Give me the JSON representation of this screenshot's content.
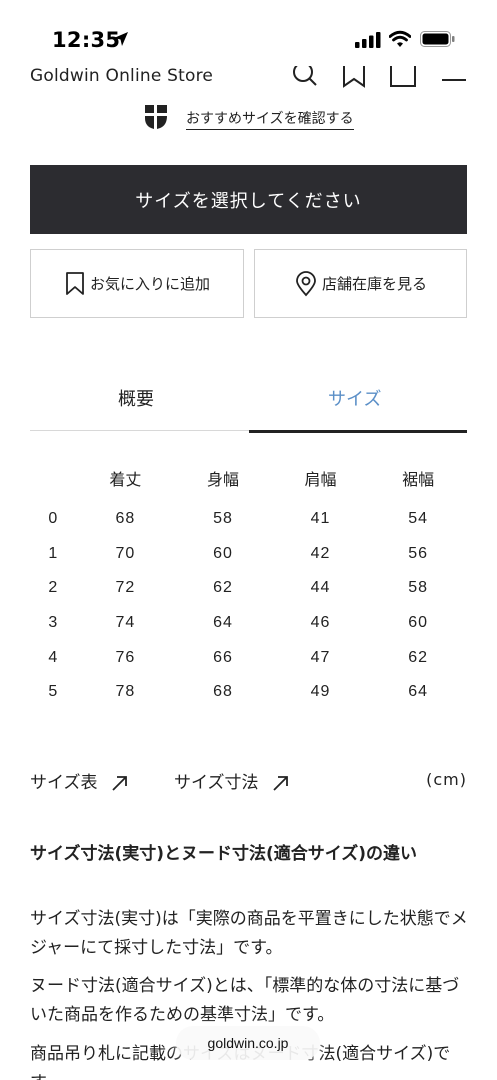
{
  "status_bar": {
    "time": "12:35"
  },
  "header": {
    "store_name": "Goldwin Online Store",
    "icons": [
      "search-icon",
      "bookmark-icon",
      "bag-icon",
      "menu-icon"
    ]
  },
  "recommend": {
    "link_label": "おすすめサイズを確認する"
  },
  "buttons": {
    "select_size": "サイズを選択してください",
    "add_favorite": "お気に入りに追加",
    "store_stock": "店舗在庫を見る"
  },
  "tabs": [
    {
      "label": "概要",
      "active": false
    },
    {
      "label": "サイズ",
      "active": true
    }
  ],
  "size_table": {
    "headers": [
      "",
      "着丈",
      "身幅",
      "肩幅",
      "裾幅"
    ],
    "rows": [
      [
        "0",
        "68",
        "58",
        "41",
        "54"
      ],
      [
        "1",
        "70",
        "60",
        "42",
        "56"
      ],
      [
        "2",
        "72",
        "62",
        "44",
        "58"
      ],
      [
        "3",
        "74",
        "64",
        "46",
        "60"
      ],
      [
        "4",
        "76",
        "66",
        "47",
        "62"
      ],
      [
        "5",
        "78",
        "68",
        "49",
        "64"
      ]
    ]
  },
  "links": {
    "size_chart": "サイズ表",
    "size_dimensions": "サイズ寸法",
    "unit": "(cm)"
  },
  "description": {
    "title": "サイズ寸法(実寸)とヌード寸法(適合サイズ)の違い",
    "p1": "サイズ寸法(実寸)は「実際の商品を平置きにした状態でメジャーにて採寸した寸法」です。",
    "p2": "ヌード寸法(適合サイズ)とは、「標準的な体の寸法に基づいた商品を作るための基準寸法」です。",
    "p3": "商品吊り札に記載のサイズはヌード寸法(適合サイズ)です。"
  },
  "browser": {
    "url": "goldwin.co.jp"
  },
  "colors": {
    "primary_button": "#2c2c30",
    "active_tab": "#5b8fc7"
  }
}
